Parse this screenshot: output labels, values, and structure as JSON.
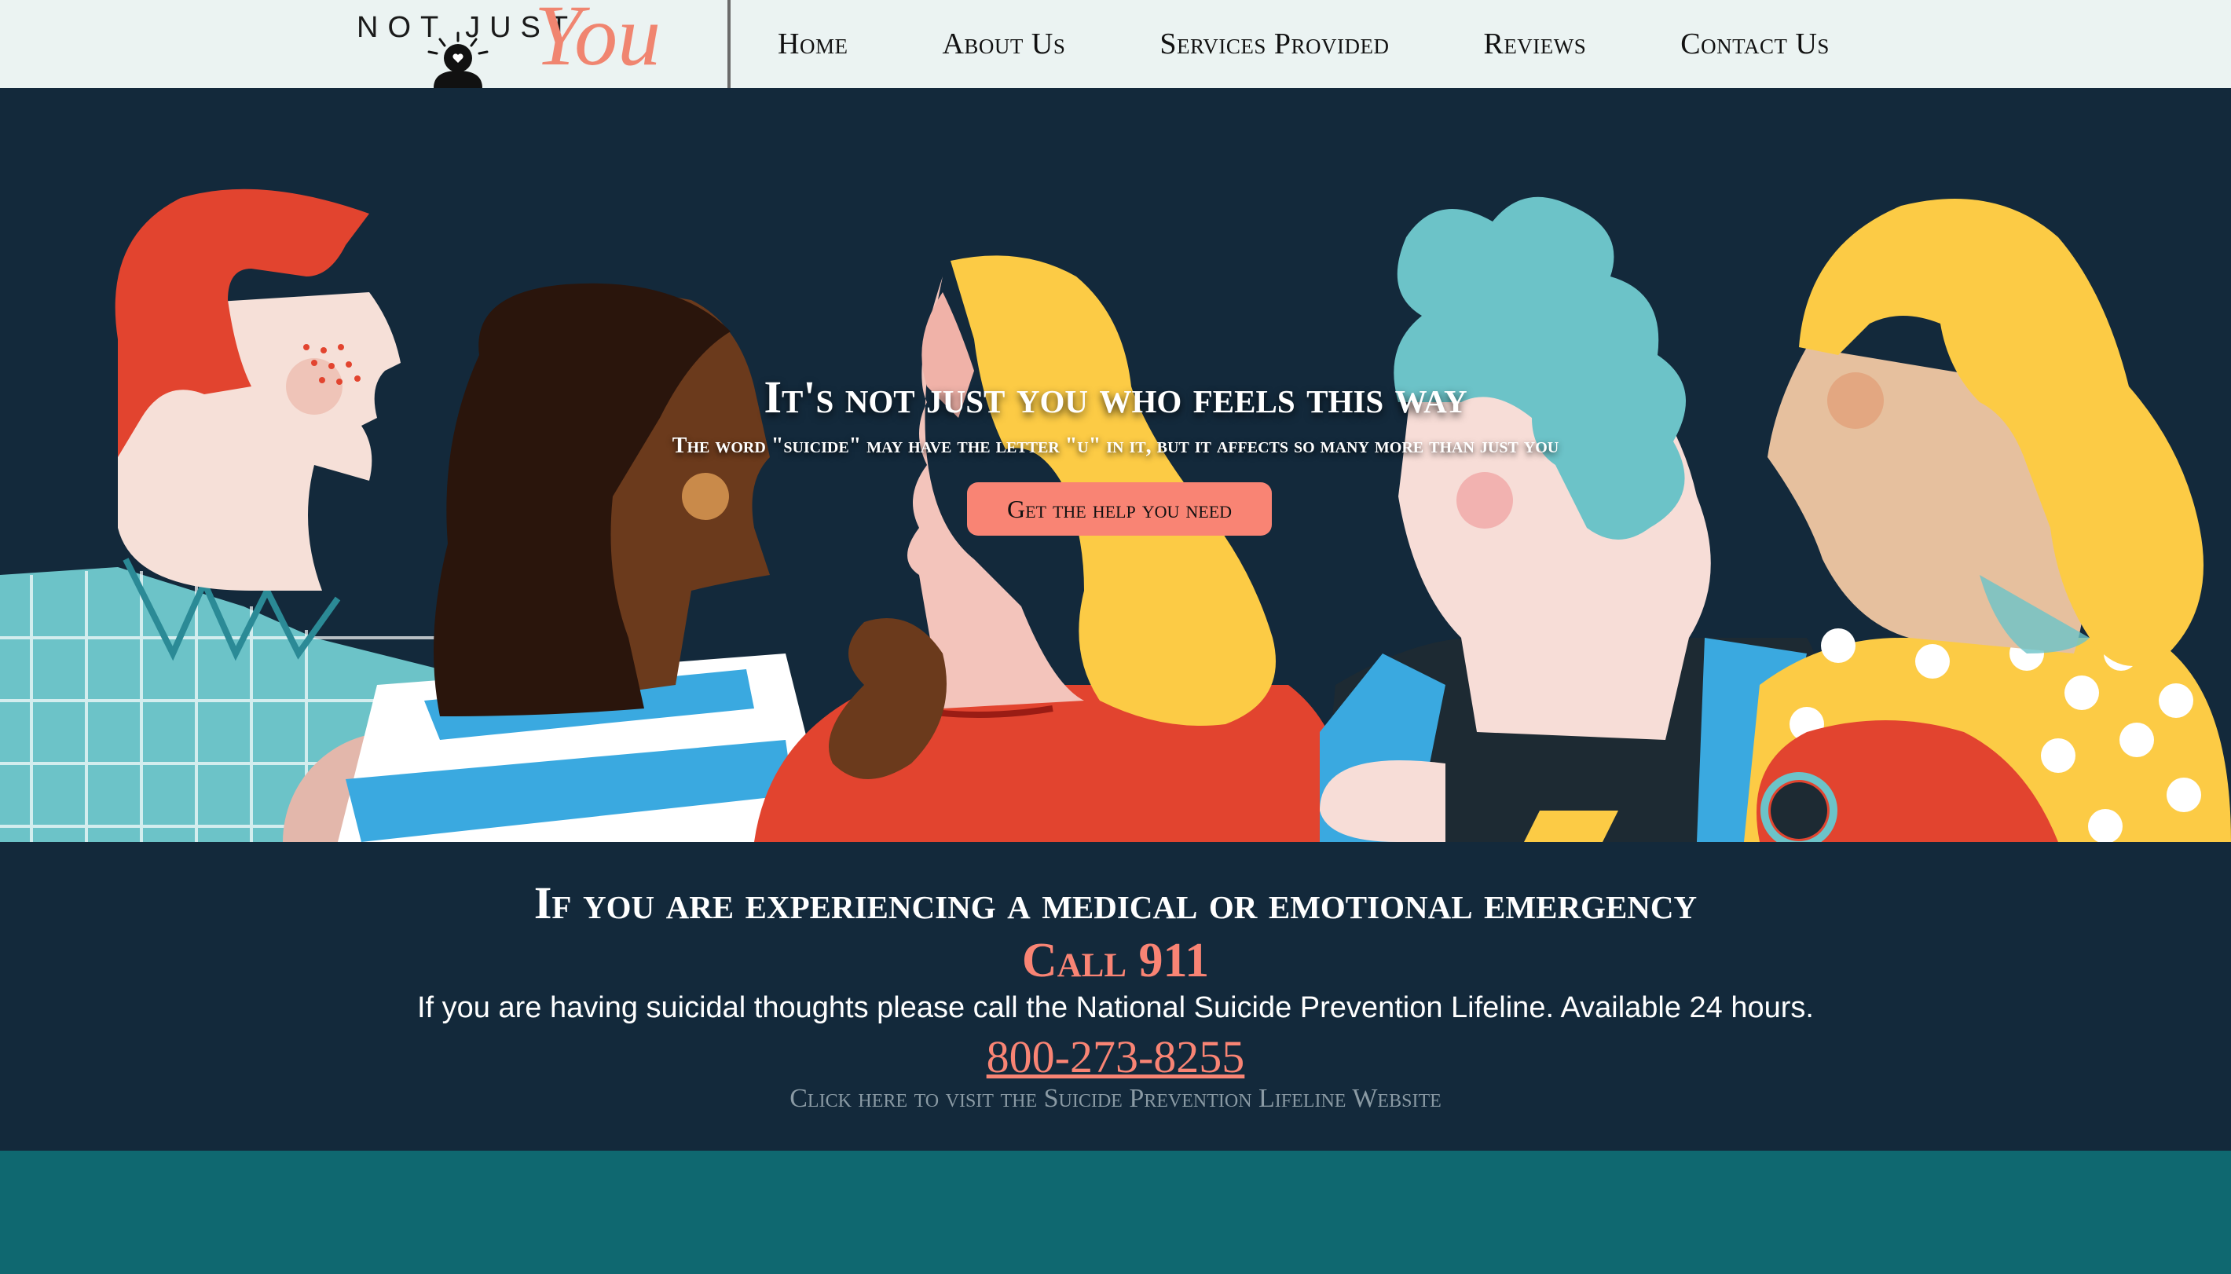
{
  "header": {
    "logo": {
      "top_text": "NOT JUST",
      "script_text": "You"
    },
    "nav": [
      "Home",
      "About Us",
      "Services Provided",
      "Reviews",
      "Contact Us"
    ]
  },
  "hero": {
    "title": "It's not just you who feels this way",
    "subtitle": "The word \"suicide\" may have the letter \"u\" in it, but it affects so many more than just you",
    "cta_label": "Get the help you need"
  },
  "emergency": {
    "heading": "If you are experiencing a medical or emotional emergency",
    "call_label": "Call 911",
    "lifeline_text": "If you are having suicidal thoughts please call the National Suicide Prevention Lifeline. Available 24 hours.",
    "phone": "800-273-8255",
    "website_link": "Click here to visit the Suicide Prevention Lifeline Website"
  },
  "colors": {
    "header_bg": "#ebf3f2",
    "navy": "#13293b",
    "coral": "#f98474",
    "teal_band": "#0f6870"
  },
  "icons": {
    "logo_figure": "person-with-heart-icon"
  }
}
